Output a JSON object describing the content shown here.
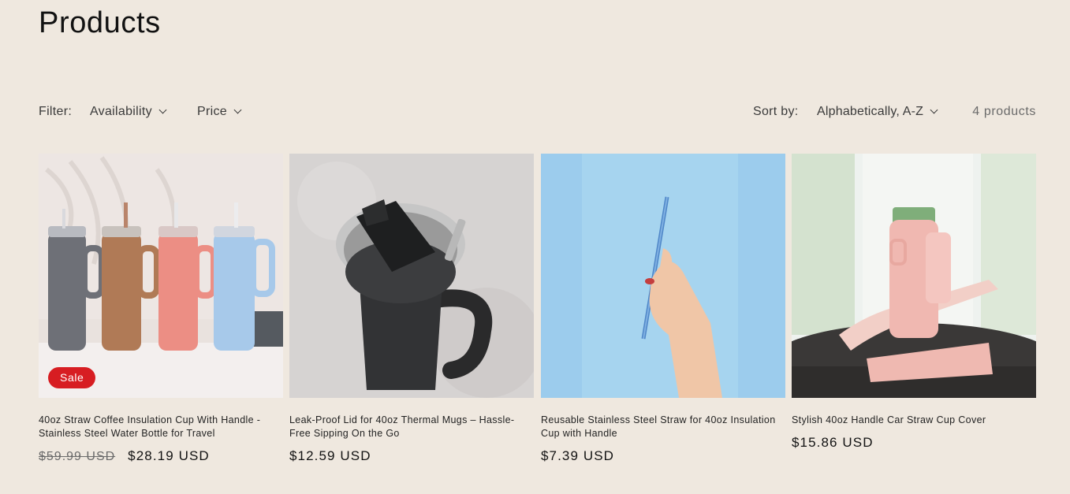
{
  "page": {
    "title": "Products"
  },
  "toolbar": {
    "filter_label": "Filter:",
    "filters": [
      "Availability",
      "Price"
    ],
    "sort_label": "Sort by:",
    "sort_value": "Alphabetically, A-Z",
    "count": "4 products"
  },
  "products": [
    {
      "name": "40oz Straw Coffee Insulation Cup With Handle - Stainless Steel Water Bottle for Travel",
      "badge": "Sale",
      "compare_price": "$59.99 USD",
      "price": "$28.19 USD",
      "image": "pastel-tumblers-image"
    },
    {
      "name": "Leak-Proof Lid for 40oz Thermal Mugs – Hassle-Free Sipping On the Go",
      "price": "$12.59 USD",
      "image": "black-mug-lid-image"
    },
    {
      "name": "Reusable Stainless Steel Straw for 40oz Insulation Cup with Handle",
      "price": "$7.39 USD",
      "image": "blue-straw-hand-image"
    },
    {
      "name": "Stylish 40oz Handle Car Straw Cup Cover",
      "price": "$15.86 USD",
      "image": "pink-cup-cover-image"
    }
  ],
  "colors": {
    "background": "#efe8df",
    "sale_badge": "#d71d22"
  }
}
